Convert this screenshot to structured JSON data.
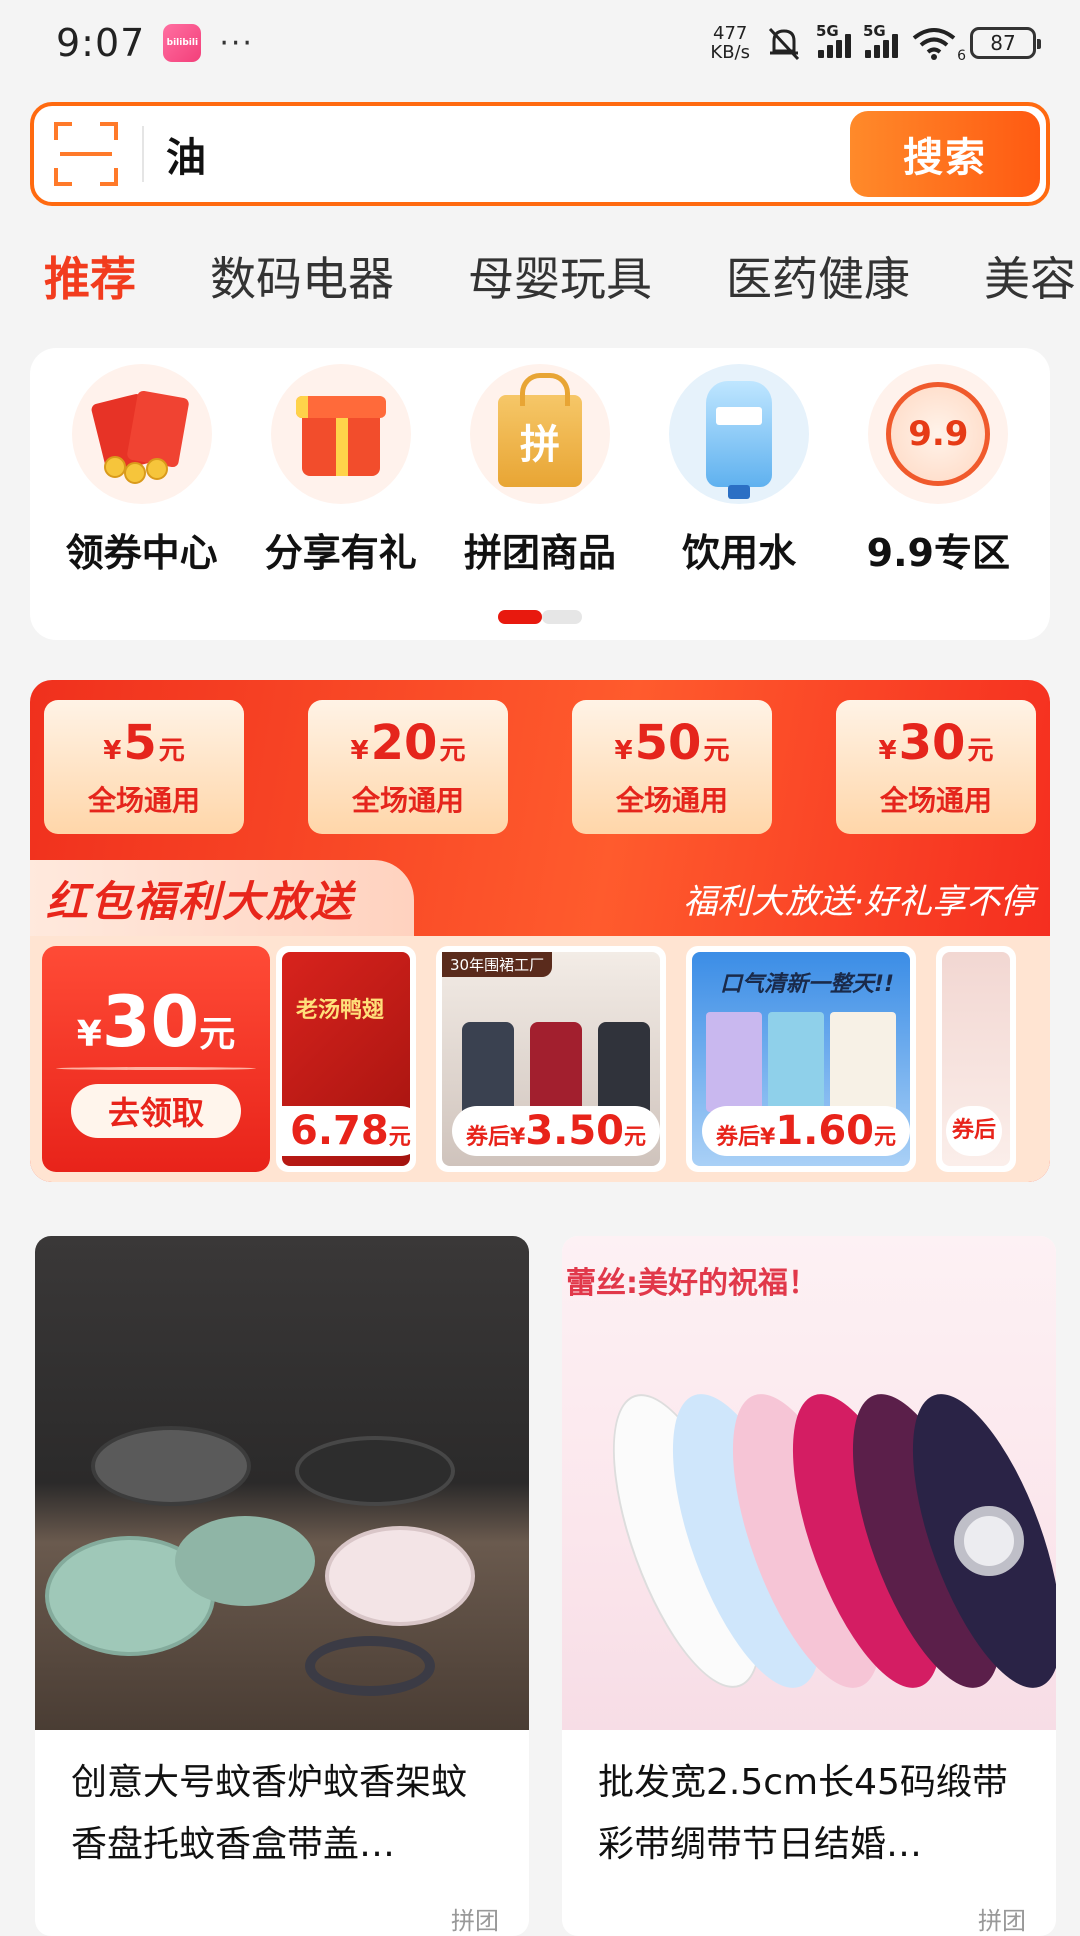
{
  "status_bar": {
    "time": "9:07",
    "app_badge": "bilibili",
    "more": "···",
    "net_speed_value": "477",
    "net_speed_unit": "KB/s",
    "sim1_label": "5G",
    "sim2_label": "5G",
    "wifi_label": "6",
    "battery": "87"
  },
  "search": {
    "query": "油",
    "button_label": "搜索"
  },
  "tabs": [
    "推荐",
    "数码电器",
    "母婴玩具",
    "医药健康",
    "美容"
  ],
  "categories": [
    {
      "label": "领券中心",
      "icon": "red-packet-icon"
    },
    {
      "label": "分享有礼",
      "icon": "gift-icon"
    },
    {
      "label": "拼团商品",
      "icon": "shopping-bag-icon"
    },
    {
      "label": "饮用水",
      "icon": "water-bottle-icon"
    },
    {
      "label": "9.9专区",
      "icon": "nine-nine-icon"
    }
  ],
  "pager": {
    "pages": 2,
    "current": 1
  },
  "promo": {
    "coupons": [
      {
        "currency": "¥",
        "amount": "5",
        "unit": "元",
        "desc": "全场通用"
      },
      {
        "currency": "¥",
        "amount": "20",
        "unit": "元",
        "desc": "全场通用"
      },
      {
        "currency": "¥",
        "amount": "50",
        "unit": "元",
        "desc": "全场通用"
      },
      {
        "currency": "¥",
        "amount": "30",
        "unit": "元",
        "desc": "全场通用"
      }
    ],
    "title": "红包福利大放送",
    "slogan": "福利大放送·好礼享不停",
    "claim": {
      "currency": "¥",
      "amount": "30",
      "unit": "元",
      "button": "去领取"
    },
    "products": [
      {
        "pre": "",
        "price": "6.78",
        "unit": "元",
        "img_text": "老汤鸭翅"
      },
      {
        "pre": "券后¥",
        "price": "3.50",
        "unit": "元",
        "img_text": "30年围裙工厂"
      },
      {
        "pre": "券后¥",
        "price": "1.60",
        "unit": "元",
        "img_text": "口气清新一整天!!"
      },
      {
        "pre": "券后",
        "price": "",
        "unit": "",
        "img_text": ""
      }
    ]
  },
  "products": [
    {
      "title": "创意大号蚊香炉蚊香架蚊香盘托蚊香盒带盖…",
      "foot": "拼团"
    },
    {
      "title": "批发宽2.5cm长45码缎带彩带绸带节日结婚…",
      "foot": "拼团",
      "banner": "蕾丝:美好的祝福！"
    }
  ],
  "colors": {
    "accent": "#f23c1e",
    "search_border": "#ff6a10",
    "promo_red": "#f0301d"
  }
}
